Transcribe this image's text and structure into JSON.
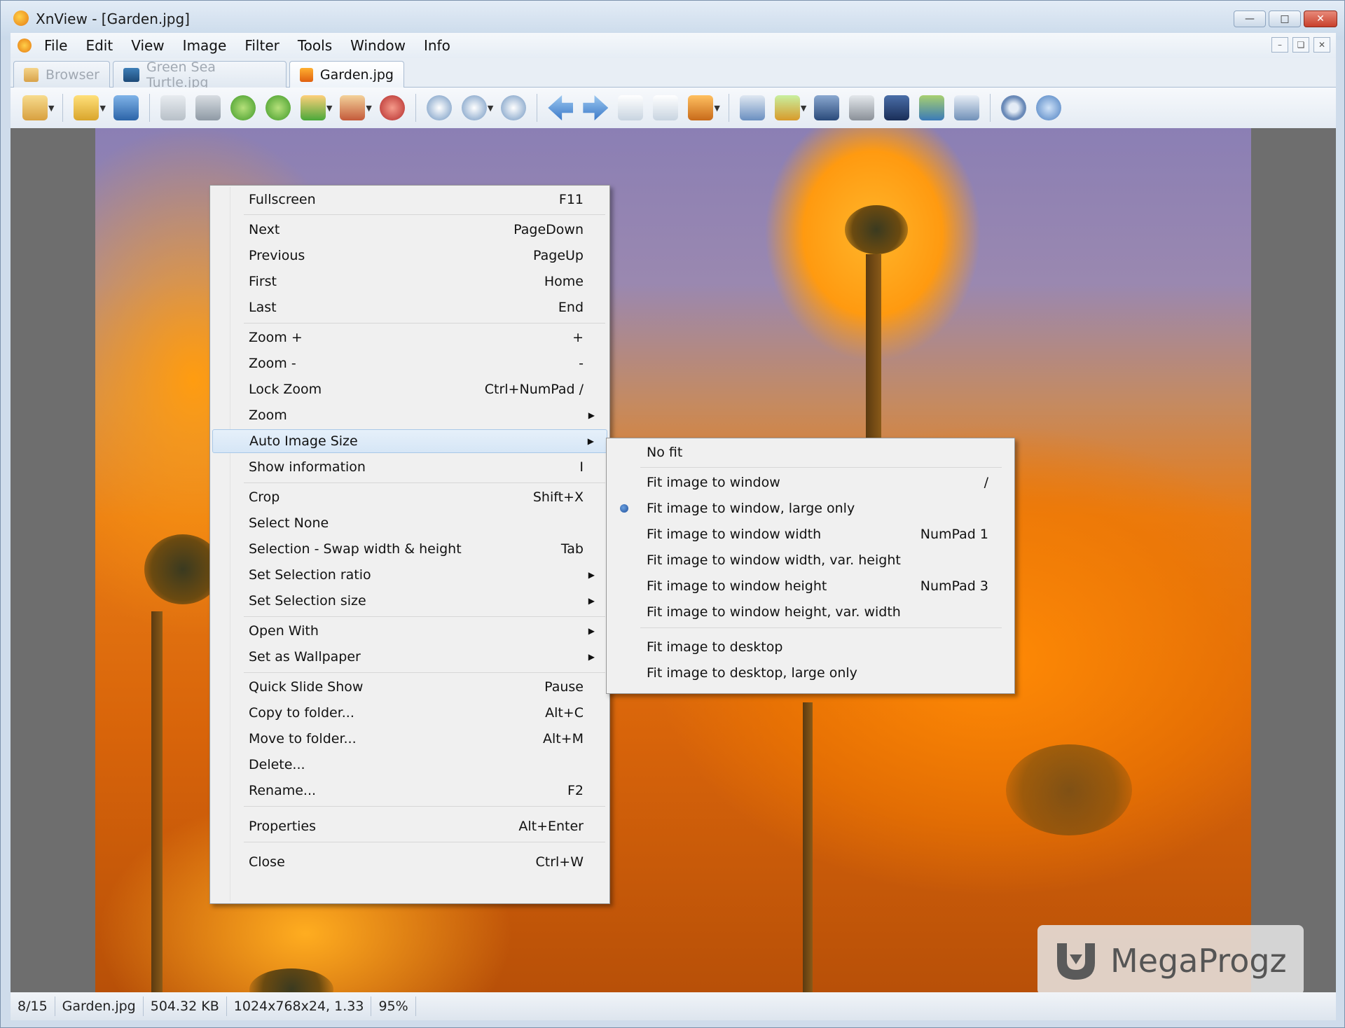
{
  "window": {
    "title": "XnView - [Garden.jpg]"
  },
  "menubar": {
    "items": [
      "File",
      "Edit",
      "View",
      "Image",
      "Filter",
      "Tools",
      "Window",
      "Info"
    ]
  },
  "tabs": [
    {
      "label": "Browser",
      "active": false
    },
    {
      "label": "Green Sea Turtle.jpg",
      "active": false
    },
    {
      "label": "Garden.jpg",
      "active": true
    }
  ],
  "toolbar_icons": [
    "browser-tree-icon",
    "open-folder-icon",
    "save-icon",
    "undo-icon",
    "crop-icon",
    "rotate-left-icon",
    "rotate-right-icon",
    "adjust-icon",
    "filter-icon",
    "effects-icon",
    "zoom-in-icon",
    "zoom-fit-icon",
    "zoom-out-icon",
    "previous-icon",
    "next-icon",
    "first-page-icon",
    "last-page-icon",
    "slideshow-icon",
    "fullscreen-icon",
    "convert-icon",
    "find-icon",
    "print-icon",
    "scan-icon",
    "wallpaper-icon",
    "capture-icon",
    "settings-icon",
    "info-icon"
  ],
  "context_menu": {
    "items": [
      {
        "label": "Fullscreen",
        "shortcut": "F11"
      },
      {
        "label": "Next",
        "shortcut": "PageDown"
      },
      {
        "label": "Previous",
        "shortcut": "PageUp"
      },
      {
        "label": "First",
        "shortcut": "Home"
      },
      {
        "label": "Last",
        "shortcut": "End"
      },
      {
        "label": "Zoom +",
        "shortcut": "+"
      },
      {
        "label": "Zoom -",
        "shortcut": "-"
      },
      {
        "label": "Lock Zoom",
        "shortcut": "Ctrl+NumPad /"
      },
      {
        "label": "Zoom",
        "shortcut": ""
      },
      {
        "label": "Auto Image Size",
        "shortcut": ""
      },
      {
        "label": "Show information",
        "shortcut": "I"
      },
      {
        "label": "Crop",
        "shortcut": "Shift+X"
      },
      {
        "label": "Select None",
        "shortcut": ""
      },
      {
        "label": "Selection - Swap width & height",
        "shortcut": "Tab"
      },
      {
        "label": "Set Selection ratio",
        "shortcut": ""
      },
      {
        "label": "Set Selection size",
        "shortcut": ""
      },
      {
        "label": "Open With",
        "shortcut": ""
      },
      {
        "label": "Set as Wallpaper",
        "shortcut": ""
      },
      {
        "label": "Quick Slide Show",
        "shortcut": "Pause"
      },
      {
        "label": "Copy to folder...",
        "shortcut": "Alt+C"
      },
      {
        "label": "Move to folder...",
        "shortcut": "Alt+M"
      },
      {
        "label": "Delete...",
        "shortcut": ""
      },
      {
        "label": "Rename...",
        "shortcut": "F2"
      },
      {
        "label": "Properties",
        "shortcut": "Alt+Enter"
      },
      {
        "label": "Close",
        "shortcut": "Ctrl+W"
      }
    ]
  },
  "submenu": {
    "items": [
      {
        "label": "No fit",
        "shortcut": ""
      },
      {
        "label": "Fit image to window",
        "shortcut": "/"
      },
      {
        "label": "Fit image to window, large only",
        "shortcut": "",
        "checked": true
      },
      {
        "label": "Fit image to window width",
        "shortcut": "NumPad 1"
      },
      {
        "label": "Fit image to window width, var. height",
        "shortcut": ""
      },
      {
        "label": "Fit image to window height",
        "shortcut": "NumPad 3"
      },
      {
        "label": "Fit image to window height, var. width",
        "shortcut": ""
      },
      {
        "label": "Fit image to desktop",
        "shortcut": ""
      },
      {
        "label": "Fit image to desktop, large only",
        "shortcut": ""
      }
    ]
  },
  "statusbar": {
    "index": "8/15",
    "filename": "Garden.jpg",
    "filesize": "504.32 KB",
    "dimensions": "1024x768x24, 1.33",
    "zoom": "95%"
  },
  "watermark": {
    "text": "MegaProgz"
  },
  "colors": {
    "accent": "#3a78c8",
    "menu_bg": "#f0f0f0",
    "highlight": "#d6e6f6",
    "photo_orange": "#ff8a05"
  }
}
